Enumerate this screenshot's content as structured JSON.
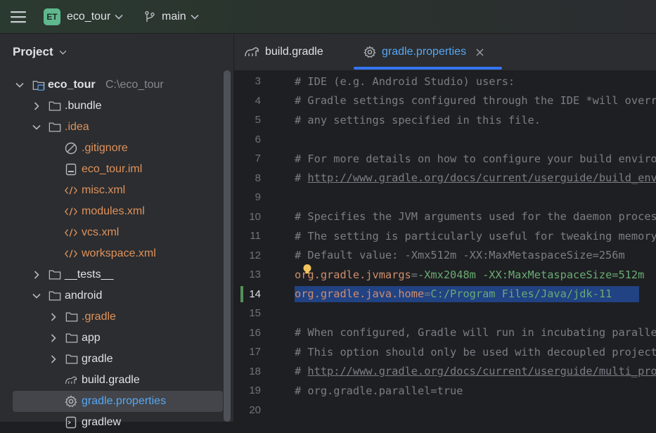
{
  "titlebar": {
    "project_badge": "ET",
    "project_name": "eco_tour",
    "branch": "main"
  },
  "project_panel": {
    "title": "Project",
    "root": {
      "name": "eco_tour",
      "path": "C:\\eco_tour"
    },
    "items": [
      {
        "label": ".bundle"
      },
      {
        "label": ".idea"
      },
      {
        "label": ".gitignore"
      },
      {
        "label": "eco_tour.iml"
      },
      {
        "label": "misc.xml"
      },
      {
        "label": "modules.xml"
      },
      {
        "label": "vcs.xml"
      },
      {
        "label": "workspace.xml"
      },
      {
        "label": "__tests__"
      },
      {
        "label": "android"
      },
      {
        "label": ".gradle"
      },
      {
        "label": "app"
      },
      {
        "label": "gradle"
      },
      {
        "label": "build.gradle"
      },
      {
        "label": "gradle.properties"
      },
      {
        "label": "gradlew"
      }
    ]
  },
  "tabs": [
    {
      "label": "build.gradle"
    },
    {
      "label": "gradle.properties"
    }
  ],
  "editor": {
    "lines": [
      {
        "num": "3",
        "text": "# IDE (e.g. Android Studio) users:"
      },
      {
        "num": "4",
        "text": "# Gradle settings configured through the IDE *will override*"
      },
      {
        "num": "5",
        "text": "# any settings specified in this file."
      },
      {
        "num": "6",
        "text": ""
      },
      {
        "num": "7",
        "text": "# For more details on how to configure your build environment visit"
      },
      {
        "num": "8",
        "text": "# ",
        "link": "http://www.gradle.org/docs/current/userguide/build_environment.html"
      },
      {
        "num": "9",
        "text": ""
      },
      {
        "num": "10",
        "text": "# Specifies the JVM arguments used for the daemon process."
      },
      {
        "num": "11",
        "text": "# The setting is particularly useful for tweaking memory settings."
      },
      {
        "num": "12",
        "text": "# Default value: -Xmx512m -XX:MaxMetaspaceSize=256m"
      },
      {
        "num": "13",
        "key": "org.gradle.jvmargs",
        "value": "-Xmx2048m -XX:MaxMetaspaceSize=512m"
      },
      {
        "num": "14",
        "key": "org.gradle.java.home",
        "value": "C:/Program Files/Java/jdk-11"
      },
      {
        "num": "15",
        "text": ""
      },
      {
        "num": "16",
        "text": "# When configured, Gradle will run in incubating parallel mode."
      },
      {
        "num": "17",
        "text": "# This option should only be used with decoupled projects. More details, visit"
      },
      {
        "num": "18",
        "text": "# ",
        "link": "http://www.gradle.org/docs/current/userguide/multi_project_builds.html"
      },
      {
        "num": "19",
        "text": "# org.gradle.parallel=true"
      },
      {
        "num": "20",
        "text": ""
      }
    ]
  },
  "colors": {
    "accent": "#3574f0",
    "badge": "#5fb88e",
    "selection": "#214283",
    "file_orange": "#e0925b",
    "key": "#cf8e6d",
    "value": "#6aab73"
  }
}
